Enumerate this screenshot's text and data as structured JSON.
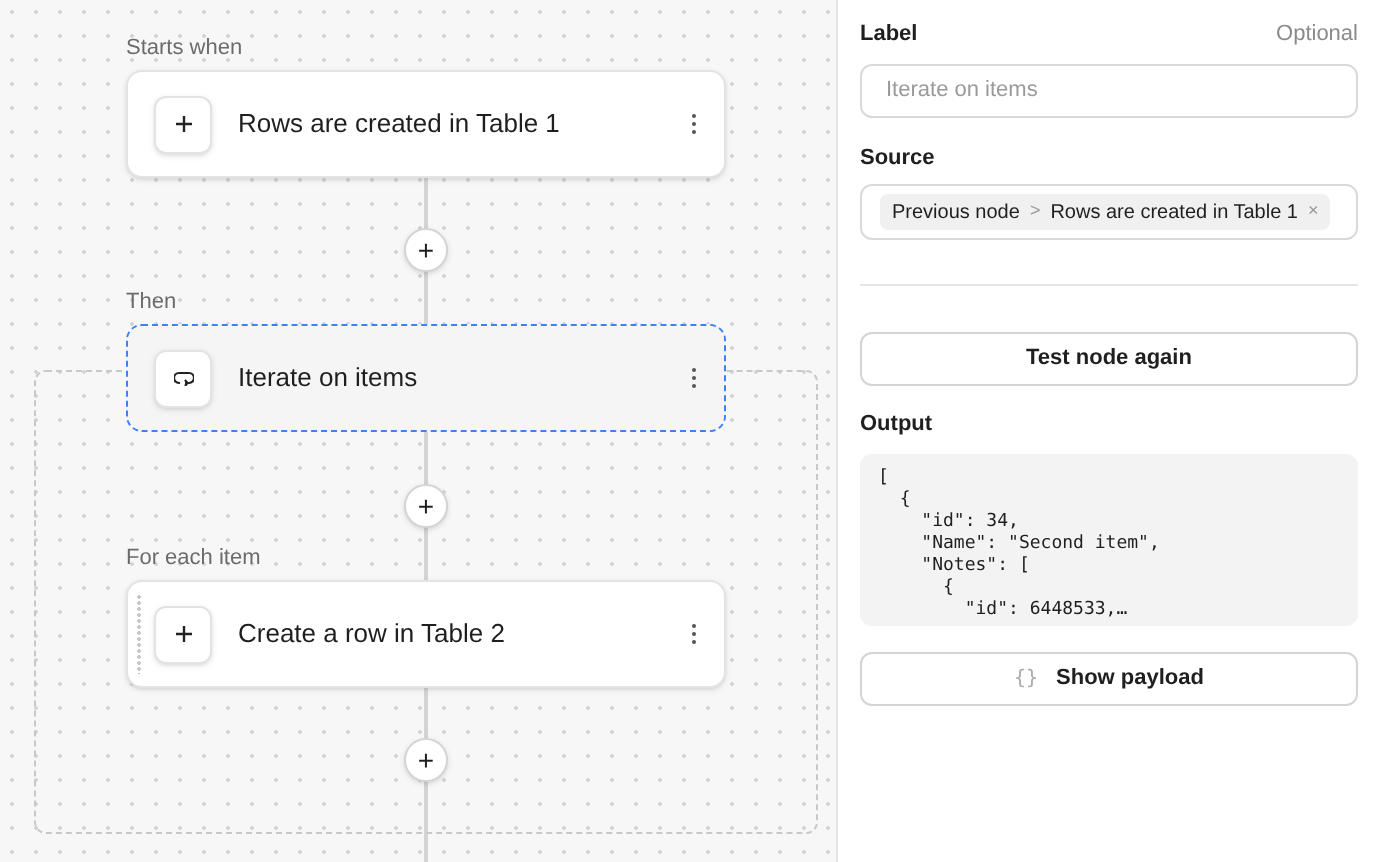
{
  "canvas": {
    "steps": [
      {
        "caption": "Starts when",
        "title": "Rows are created in Table 1",
        "kind": "plus",
        "selected": false,
        "handle": false
      },
      {
        "caption": "Then",
        "title": "Iterate on items",
        "kind": "loop",
        "selected": true,
        "handle": false
      },
      {
        "caption": "For each item",
        "title": "Create a row in Table 2",
        "kind": "plus",
        "selected": false,
        "handle": true
      }
    ],
    "add_buttons": [
      "+",
      "+",
      "+"
    ]
  },
  "panel": {
    "label_field": {
      "label": "Label",
      "hint": "Optional",
      "placeholder": "Iterate on items"
    },
    "source_field": {
      "label": "Source",
      "chip": {
        "parts": [
          "Previous node",
          "Rows are created in Table 1"
        ],
        "separator": ">",
        "remove": "×"
      }
    },
    "test_button": "Test node again",
    "output": {
      "label": "Output",
      "lines": [
        "[",
        "  {",
        "    \"id\": 34,",
        "    \"Name\": \"Second item\",",
        "    \"Notes\": [",
        "      {",
        "        \"id\": 6448533,…"
      ]
    },
    "payload_button": {
      "icon": "{}",
      "label": "Show payload"
    }
  }
}
